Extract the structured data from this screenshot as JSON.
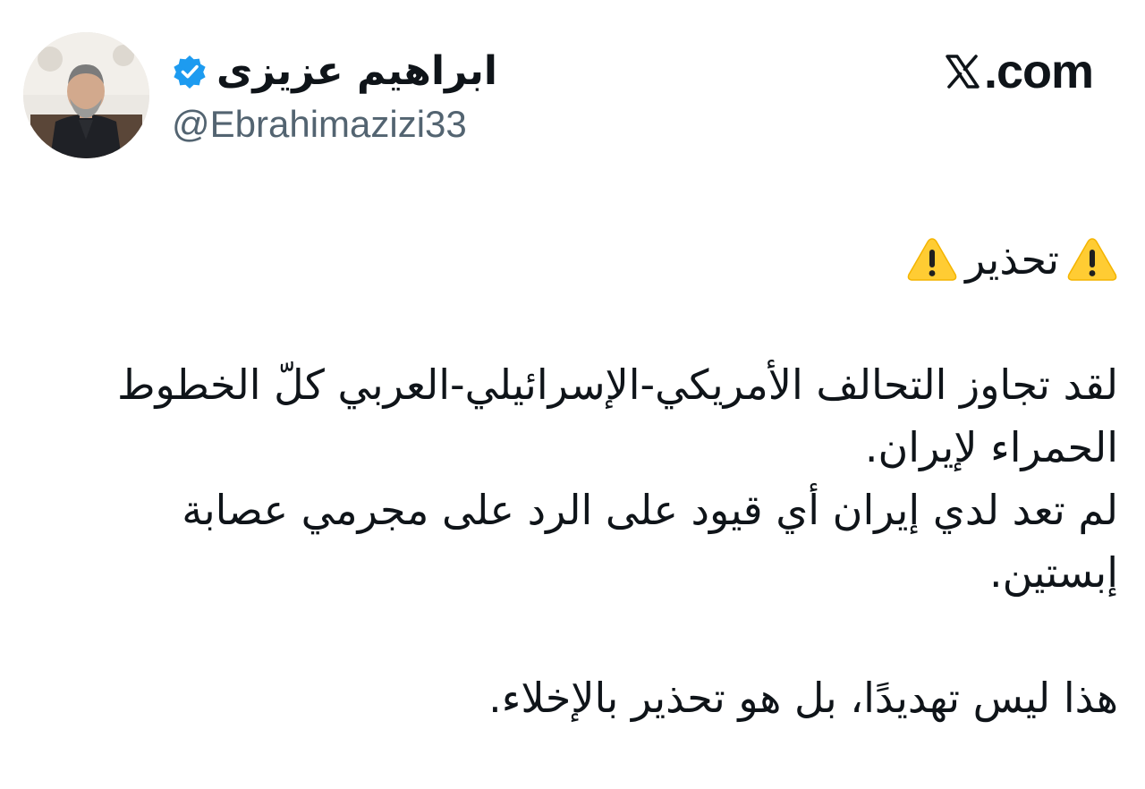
{
  "author": {
    "name": "ابراهیم عزیزی",
    "handle": "@Ebrahimazizi33",
    "verified": true
  },
  "site": {
    "domain": ".com",
    "logo": "x-logo-icon"
  },
  "tweet": {
    "heading": "تحذير",
    "heading_icon": "warning-icon",
    "line1": "لقد تجاوز التحالف الأمريكي-الإسرائيلي-العربي كلّ الخطوط",
    "line2": "الحمراء لإيران.",
    "line3": "لم تعد لدي إيران أي قيود على الرد على مجرمي عصابة",
    "line4": "إبستين.",
    "line5": "هذا ليس تهديدًا، بل هو تحذير بالإخلاء."
  },
  "colors": {
    "verified_badge": "#1d9bf0",
    "handle_text": "#536471",
    "text": "#0f1419",
    "warning_fill": "#ffcc33"
  }
}
